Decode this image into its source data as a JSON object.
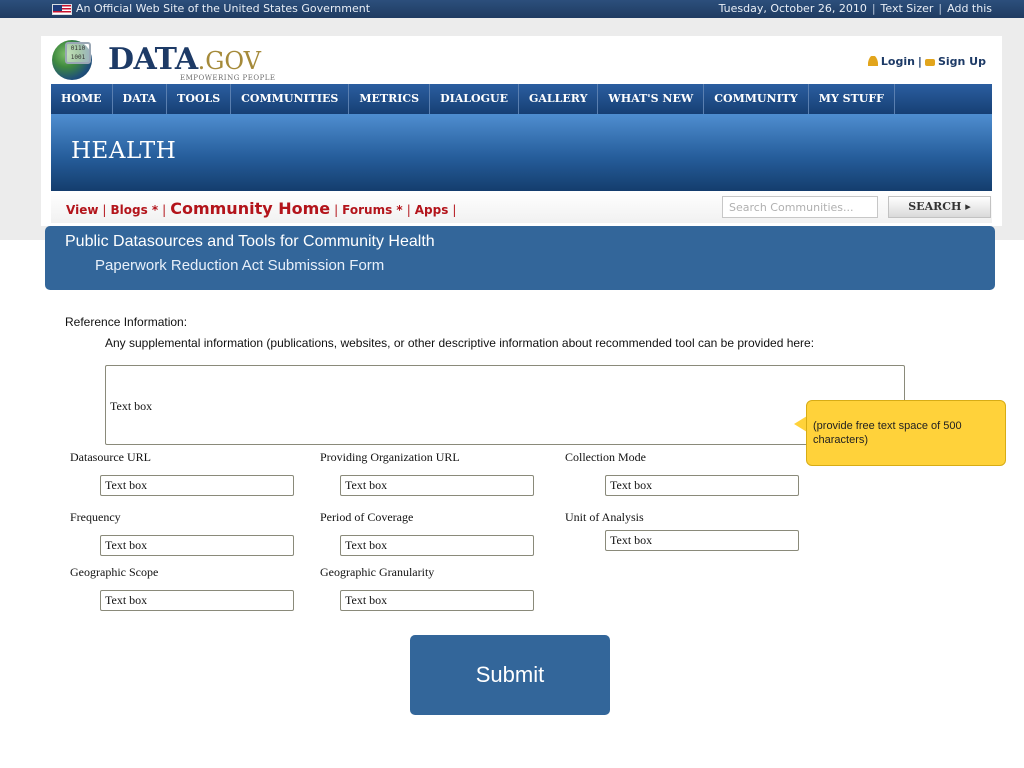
{
  "topbar": {
    "official": "An Official Web Site of the United States Government",
    "date": "Tuesday, October 26, 2010",
    "text_sizer": "Text Sizer",
    "add_this": "Add this",
    "sep": "|"
  },
  "logo": {
    "name": "DATA",
    "suffix": ".GOV",
    "tagline": "EMPOWERING PEOPLE",
    "binary": "0110 1001"
  },
  "auth": {
    "login": "Login",
    "signup": "Sign Up",
    "sep": "|"
  },
  "nav": [
    "HOME",
    "DATA",
    "TOOLS",
    "COMMUNITIES",
    "METRICS",
    "DIALOGUE",
    "GALLERY",
    "WHAT'S NEW",
    "COMMUNITY",
    "MY STUFF"
  ],
  "banner": {
    "title": "HEALTH"
  },
  "subnav": {
    "view": "View",
    "blogs": "Blogs *",
    "community_home": "Community Home",
    "forums": "Forums *",
    "apps": "Apps",
    "sep": "|"
  },
  "search": {
    "placeholder": "Search Communities...",
    "button": "SEARCH ▸"
  },
  "page": {
    "title": "Public Datasources and Tools for Community Health",
    "subtitle": "Paperwork Reduction Act Submission Form"
  },
  "form": {
    "reference_label": "Reference Information:",
    "reference_help": "Any supplemental information (publications, websites, or other descriptive information about recommended tool can be provided here:",
    "reference_value": "Text box",
    "note": "(provide free text space of 500 characters)",
    "fields": [
      {
        "label": "Datasource URL",
        "value": "Text box"
      },
      {
        "label": "Providing Organization URL",
        "value": "Text box"
      },
      {
        "label": "Collection Mode",
        "value": "Text box"
      },
      {
        "label": "Frequency",
        "value": "Text box"
      },
      {
        "label": "Period of Coverage",
        "value": "Text box"
      },
      {
        "label": "Unit of Analysis",
        "value": "Text box"
      },
      {
        "label": "Geographic Scope",
        "value": "Text box"
      },
      {
        "label": "Geographic Granularity",
        "value": "Text box"
      }
    ],
    "submit": "Submit"
  },
  "colors": {
    "nav": "#1f4a84",
    "panel": "#33669a",
    "note": "#ffd23a",
    "link_red": "#b3141b"
  }
}
